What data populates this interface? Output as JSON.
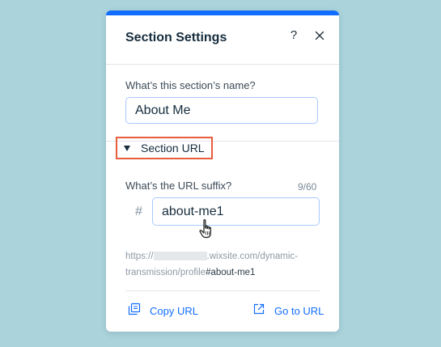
{
  "panel": {
    "title": "Section Settings",
    "help_label": "?",
    "accent_color": "#116dff",
    "highlight_color": "#e85d3c"
  },
  "section_name": {
    "label": "What’s this section’s name?",
    "value": "About Me"
  },
  "section_url": {
    "toggle_label": "Section URL",
    "suffix_label": "What’s the URL suffix?",
    "counter": "9/60",
    "hash": "#",
    "suffix_value": "about-me1",
    "preview_prefix": "https://",
    "preview_domain": ".wixsite.com/dynamic-transmission/profile",
    "preview_suffix": "#about-me1"
  },
  "footer": {
    "copy_url_label": "Copy URL",
    "goto_url_label": "Go to URL"
  },
  "icons": {
    "close": "close-icon",
    "help": "help-icon",
    "caret": "caret-down-icon",
    "copy": "copy-icon",
    "external_link": "external-link-icon",
    "cursor": "hand-pointer-cursor-icon"
  }
}
